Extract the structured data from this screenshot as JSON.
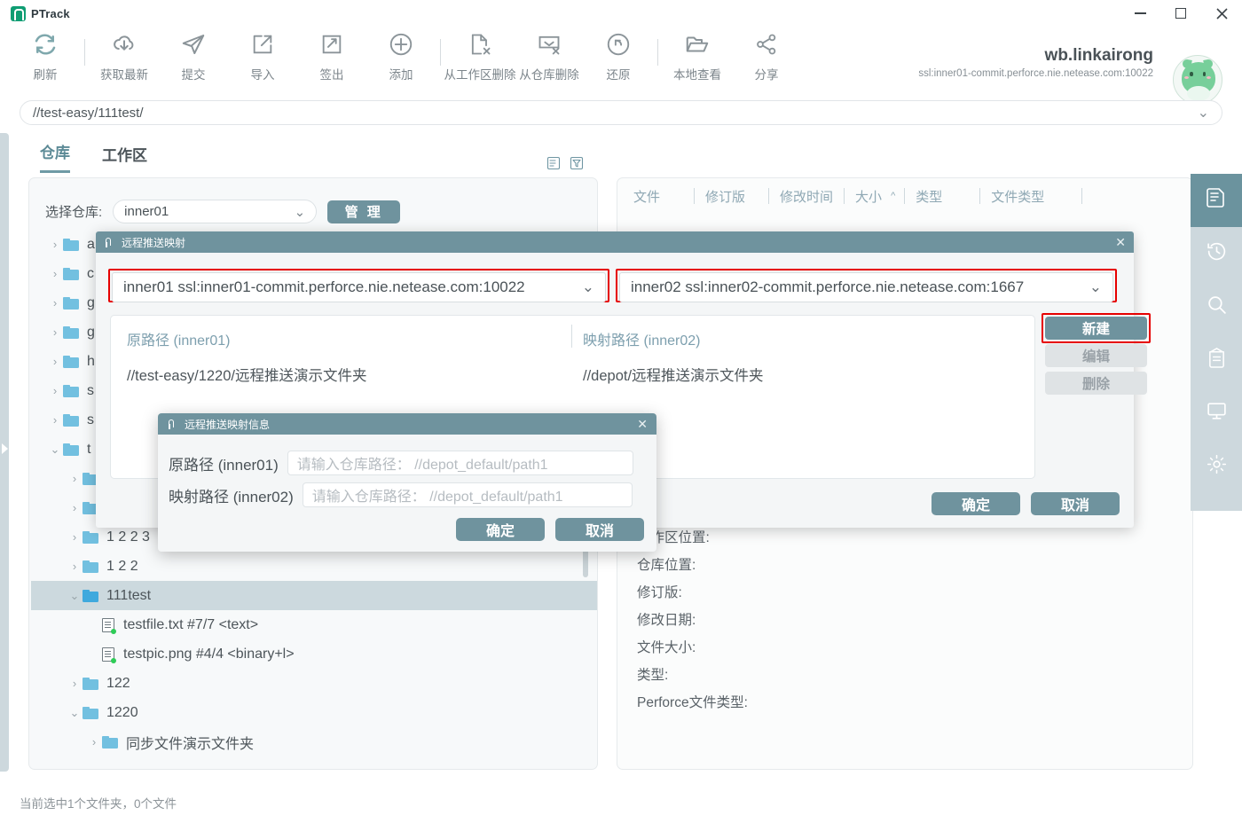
{
  "window": {
    "app_title": "PTrack",
    "minimize": "−",
    "maximize": "□",
    "close": "✕"
  },
  "toolbar": {
    "items": [
      {
        "label": "刷新",
        "icon": "refresh-icon"
      },
      {
        "label": "获取最新",
        "icon": "cloud-download-icon"
      },
      {
        "label": "提交",
        "icon": "send-icon"
      },
      {
        "label": "导入",
        "icon": "import-icon"
      },
      {
        "label": "签出",
        "icon": "checkout-edit-icon"
      },
      {
        "label": "添加",
        "icon": "plus-circle-icon"
      },
      {
        "label": "从工作区删除",
        "icon": "file-delete-icon"
      },
      {
        "label": "从仓库删除",
        "icon": "depot-delete-icon"
      },
      {
        "label": "还原",
        "icon": "revert-icon"
      },
      {
        "label": "本地查看",
        "icon": "folder-open-icon"
      },
      {
        "label": "分享",
        "icon": "share-icon"
      }
    ]
  },
  "user": {
    "name": "wb.linkairong",
    "server": "ssl:inner01-commit.perforce.nie.netease.com:10022"
  },
  "pathbar": {
    "value": "//test-easy/111test/",
    "chevron": "⌄"
  },
  "tabs": [
    {
      "label": "仓库",
      "active": true
    },
    {
      "label": "工作区",
      "active": false
    }
  ],
  "header_icons": [
    {
      "name": "sort-icon"
    },
    {
      "name": "filter-icon"
    }
  ],
  "left_panel": {
    "repo_label": "选择仓库:",
    "repo_value": "inner01",
    "repo_chevron": "⌄",
    "manage_button": "管 理",
    "tree": [
      {
        "label": "a",
        "kind": "folder",
        "depth": 0,
        "expanded": false,
        "selected": false
      },
      {
        "label": "c",
        "kind": "folder",
        "depth": 0,
        "expanded": false,
        "selected": false
      },
      {
        "label": "g",
        "kind": "folder",
        "depth": 0,
        "expanded": false,
        "selected": false
      },
      {
        "label": "g",
        "kind": "folder",
        "depth": 0,
        "expanded": false,
        "selected": false
      },
      {
        "label": "h",
        "kind": "folder",
        "depth": 0,
        "expanded": false,
        "selected": false
      },
      {
        "label": "s",
        "kind": "folder",
        "depth": 0,
        "expanded": false,
        "selected": false
      },
      {
        "label": "s",
        "kind": "folder",
        "depth": 0,
        "expanded": false,
        "selected": false
      },
      {
        "label": "t",
        "kind": "folder",
        "depth": 0,
        "expanded": true,
        "selected": false
      },
      {
        "label": "",
        "kind": "folder",
        "depth": 1,
        "expanded": false,
        "selected": false
      },
      {
        "label": "",
        "kind": "folder",
        "depth": 1,
        "expanded": false,
        "selected": false
      },
      {
        "label": "1 2 2 3",
        "kind": "folder",
        "depth": 1,
        "expanded": false,
        "selected": false
      },
      {
        "label": "1 2 2",
        "kind": "folder",
        "depth": 1,
        "expanded": false,
        "selected": false
      },
      {
        "label": "111test",
        "kind": "folder",
        "depth": 1,
        "expanded": true,
        "selected": true
      },
      {
        "label": "testfile.txt  #7/7 <text>",
        "kind": "file",
        "depth": 2,
        "expanded": false,
        "selected": false
      },
      {
        "label": "testpic.png  #4/4 <binary+l>",
        "kind": "file",
        "depth": 2,
        "expanded": false,
        "selected": false
      },
      {
        "label": "122",
        "kind": "folder",
        "depth": 1,
        "expanded": false,
        "selected": false
      },
      {
        "label": "1220",
        "kind": "folder",
        "depth": 1,
        "expanded": true,
        "selected": false
      },
      {
        "label": "同步文件演示文件夹",
        "kind": "folder",
        "depth": 2,
        "expanded": false,
        "selected": false
      }
    ]
  },
  "right_panel": {
    "columns": [
      "文件",
      "修订版",
      "修改时间",
      "大小",
      "类型",
      "文件类型"
    ],
    "sort_indicator": "^",
    "details": [
      "工作区位置:",
      "仓库位置:",
      "修订版:",
      "修改日期:",
      "文件大小:",
      "类型:",
      "Perforce文件类型:"
    ]
  },
  "right_rail": [
    {
      "name": "document-icon",
      "active": true
    },
    {
      "name": "history-icon",
      "active": false
    },
    {
      "name": "search-icon",
      "active": false
    },
    {
      "name": "archive-icon",
      "active": false
    },
    {
      "name": "monitor-icon",
      "active": false
    },
    {
      "name": "gear-icon",
      "active": false
    }
  ],
  "statusbar": {
    "text": "当前选中1个文件夹，0个文件"
  },
  "dialog_mapping": {
    "title": "远程推送映射",
    "close": "✕",
    "source_dropdown": "inner01  ssl:inner01-commit.perforce.nie.netease.com:10022",
    "target_dropdown": "inner02  ssl:inner02-commit.perforce.nie.netease.com:1667",
    "chevron": "⌄",
    "col_source_header": "原路径 (inner01)",
    "col_target_header": "映射路径 (inner02)",
    "row_source_value": "//test-easy/1220/远程推送演示文件夹",
    "row_target_value": "//depot/远程推送演示文件夹",
    "side_buttons": [
      {
        "label": "新建",
        "state": "primary"
      },
      {
        "label": "编辑",
        "state": "muted"
      },
      {
        "label": "删除",
        "state": "muted"
      }
    ],
    "ok": "确定",
    "cancel": "取消"
  },
  "dialog_mapping_info": {
    "title": "远程推送映射信息",
    "close": "✕",
    "source_label": "原路径 (inner01)",
    "source_placeholder": "请输入仓库路径： //depot_default/path1",
    "target_label": "映射路径 (inner02)",
    "target_placeholder": "请输入仓库路径： //depot_default/path1",
    "ok": "确定",
    "cancel": "取消"
  },
  "colors": {
    "accent": "#6f939e",
    "highlight_red": "#e60000",
    "folder_blue": "#72c0e0",
    "rail_bg": "#cdd8dd"
  }
}
